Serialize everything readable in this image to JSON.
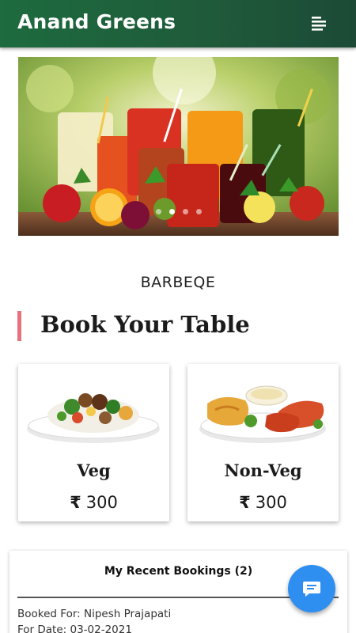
{
  "header": {
    "title": "Anand Greens",
    "menu_icon": "menu-icon"
  },
  "carousel": {
    "image": "juice-glasses-with-fruits",
    "slide_count": 4,
    "active_slide": 1
  },
  "restaurant": {
    "name": "BARBEQE"
  },
  "section": {
    "title": "Book Your Table",
    "accent_color": "#e7717d"
  },
  "menu_cards": [
    {
      "label": "Veg",
      "currency_symbol": "₹",
      "price": "300",
      "image": "veg-dish-plate"
    },
    {
      "label": "Non-Veg",
      "currency_symbol": "₹",
      "price": "300",
      "image": "non-veg-chicken-plate"
    }
  ],
  "recent_bookings": {
    "title": "My Recent Bookings (2)",
    "items": [
      {
        "booked_for": "Booked For: Nipesh Prajapati",
        "for_date": "For Date: 03-02-2021"
      }
    ]
  },
  "fab": {
    "icon": "chat-icon",
    "color": "#2f8ff0"
  },
  "colors": {
    "app_bar": "#1f5a3a",
    "text": "#1b1b1b"
  }
}
